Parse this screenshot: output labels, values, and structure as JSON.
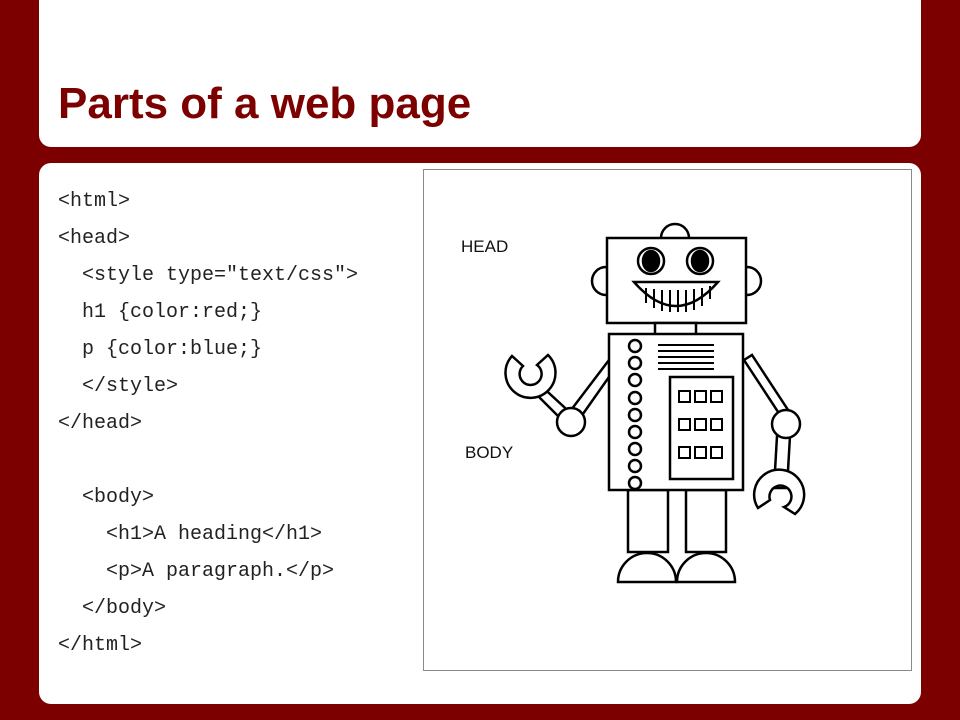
{
  "slide": {
    "title": "Parts of a web page",
    "code_lines": [
      "<html>",
      "<head>",
      "  <style type=\"text/css\">",
      "  h1 {color:red;}",
      "  p {color:blue;}",
      "  </style>",
      "</head>",
      "",
      "  <body>",
      "    <h1>A heading</h1>",
      "    <p>A paragraph.</p>",
      "  </body>",
      "</html>"
    ],
    "figure": {
      "head_label": "HEAD",
      "body_label": "BODY"
    }
  },
  "colors": {
    "background": "#7d0000",
    "title": "#7d0000",
    "panel": "#ffffff"
  }
}
